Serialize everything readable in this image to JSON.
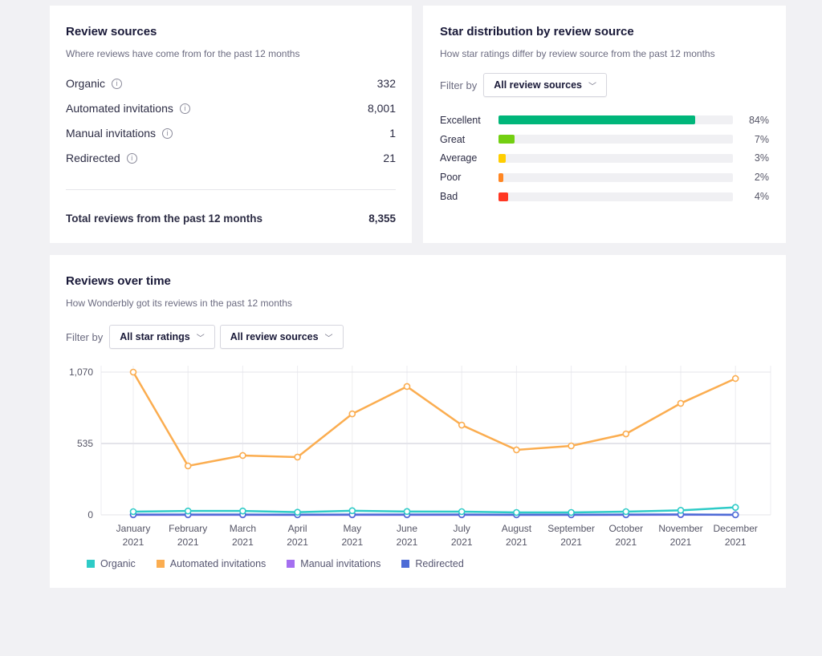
{
  "sources": {
    "title": "Review sources",
    "subtitle": "Where reviews have come from for the past 12 months",
    "items": [
      {
        "label": "Organic",
        "value": "332"
      },
      {
        "label": "Automated invitations",
        "value": "8,001"
      },
      {
        "label": "Manual invitations",
        "value": "1"
      },
      {
        "label": "Redirected",
        "value": "21"
      }
    ],
    "total_label": "Total reviews from the past 12 months",
    "total_value": "8,355"
  },
  "stars": {
    "title": "Star distribution by review source",
    "subtitle": "How star ratings differ by review source from the past 12 months",
    "filter_label": "Filter by",
    "filter_value": "All review sources",
    "bars": [
      {
        "label": "Excellent",
        "pct": 84,
        "text": "84%",
        "color": "#00b67a"
      },
      {
        "label": "Great",
        "pct": 7,
        "text": "7%",
        "color": "#73cf11"
      },
      {
        "label": "Average",
        "pct": 3,
        "text": "3%",
        "color": "#ffce00"
      },
      {
        "label": "Poor",
        "pct": 2,
        "text": "2%",
        "color": "#ff8622"
      },
      {
        "label": "Bad",
        "pct": 4,
        "text": "4%",
        "color": "#ff3722"
      }
    ]
  },
  "overtime": {
    "title": "Reviews over time",
    "subtitle": "How Wonderbly got its reviews in the past 12 months",
    "filter_label": "Filter by",
    "filter1": "All star ratings",
    "filter2": "All review sources"
  },
  "chart_data": {
    "type": "line",
    "ylim": [
      0,
      1070
    ],
    "yticks": [
      "0",
      "535",
      "1,070"
    ],
    "grid": true,
    "legend": "bottom-left",
    "categories": [
      [
        "January",
        "2021"
      ],
      [
        "February",
        "2021"
      ],
      [
        "March",
        "2021"
      ],
      [
        "April",
        "2021"
      ],
      [
        "May",
        "2021"
      ],
      [
        "June",
        "2021"
      ],
      [
        "July",
        "2021"
      ],
      [
        "August",
        "2021"
      ],
      [
        "September",
        "2021"
      ],
      [
        "October",
        "2021"
      ],
      [
        "November",
        "2021"
      ],
      [
        "December",
        "2021"
      ]
    ],
    "series": [
      {
        "name": "Organic",
        "color": "#2ecbc7",
        "values": [
          24,
          29,
          29,
          20,
          31,
          25,
          24,
          18,
          18,
          24,
          34,
          56
        ]
      },
      {
        "name": "Automated invitations",
        "color": "#fbad50",
        "values": [
          1070,
          367,
          445,
          433,
          757,
          962,
          673,
          487,
          517,
          607,
          836,
          1022
        ]
      },
      {
        "name": "Manual invitations",
        "color": "#a46ff0",
        "values": [
          0,
          0,
          0,
          0,
          0,
          0,
          0,
          0,
          0,
          0,
          1,
          0
        ]
      },
      {
        "name": "Redirected",
        "color": "#4d6bd6",
        "values": [
          2,
          2,
          2,
          1,
          2,
          2,
          2,
          1,
          1,
          2,
          3,
          1
        ]
      }
    ]
  }
}
